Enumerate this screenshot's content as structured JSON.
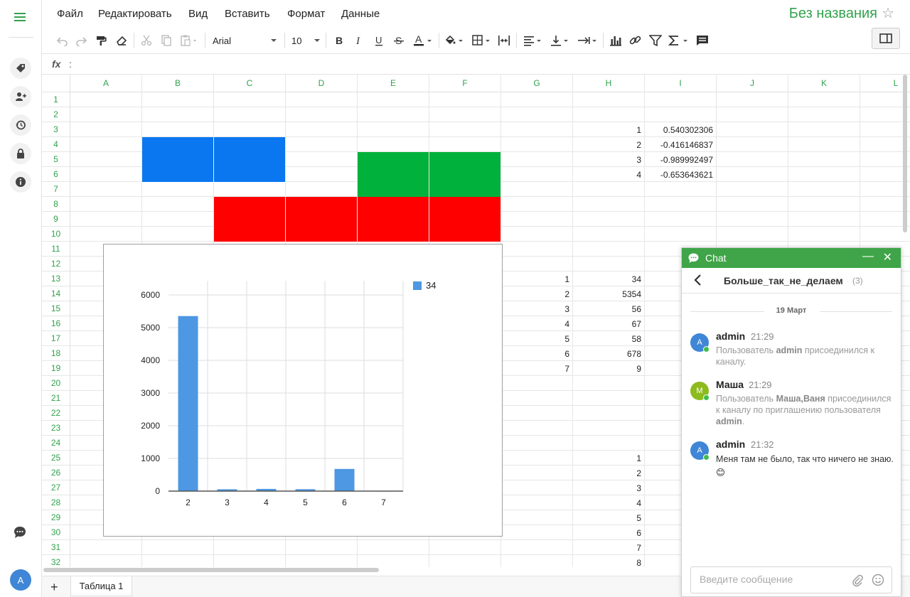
{
  "menu": [
    "Файл",
    "Редактировать",
    "Вид",
    "Вставить",
    "Формат",
    "Данные"
  ],
  "document_title": "Без названия",
  "toolbar": {
    "font_family": "Arial",
    "font_size": "10",
    "text_color": "#222222",
    "fill_color": "#222222"
  },
  "formula_bar": {
    "label": "fx",
    "separator": ":"
  },
  "columns": [
    "A",
    "B",
    "C",
    "D",
    "E",
    "F",
    "G",
    "H",
    "I",
    "J",
    "K",
    "L"
  ],
  "rows": [
    "1",
    "2",
    "3",
    "4",
    "5",
    "6",
    "7",
    "8",
    "9",
    "10",
    "11",
    "12",
    "13",
    "14",
    "15",
    "16",
    "17",
    "18",
    "19",
    "20",
    "21",
    "22",
    "23",
    "24",
    "25",
    "26",
    "27",
    "28",
    "29",
    "30",
    "31",
    "32"
  ],
  "cells": [
    {
      "ref": "H3",
      "value": "1"
    },
    {
      "ref": "I3",
      "value": "0.540302306"
    },
    {
      "ref": "H4",
      "value": "2"
    },
    {
      "ref": "I4",
      "value": "-0.416146837"
    },
    {
      "ref": "H5",
      "value": "3"
    },
    {
      "ref": "I5",
      "value": "-0.989992497"
    },
    {
      "ref": "H6",
      "value": "4"
    },
    {
      "ref": "I6",
      "value": "-0.653643621"
    },
    {
      "ref": "G13",
      "value": "1"
    },
    {
      "ref": "H13",
      "value": "34"
    },
    {
      "ref": "G14",
      "value": "2"
    },
    {
      "ref": "H14",
      "value": "5354"
    },
    {
      "ref": "G15",
      "value": "3"
    },
    {
      "ref": "H15",
      "value": "56"
    },
    {
      "ref": "G16",
      "value": "4"
    },
    {
      "ref": "H16",
      "value": "67"
    },
    {
      "ref": "G17",
      "value": "5"
    },
    {
      "ref": "H17",
      "value": "58"
    },
    {
      "ref": "G18",
      "value": "6"
    },
    {
      "ref": "H18",
      "value": "678"
    },
    {
      "ref": "G19",
      "value": "7"
    },
    {
      "ref": "H19",
      "value": "9"
    },
    {
      "ref": "H25",
      "value": "1"
    },
    {
      "ref": "H26",
      "value": "2"
    },
    {
      "ref": "H27",
      "value": "3"
    },
    {
      "ref": "H28",
      "value": "4"
    },
    {
      "ref": "H29",
      "value": "5"
    },
    {
      "ref": "H30",
      "value": "6"
    },
    {
      "ref": "H31",
      "value": "7"
    },
    {
      "ref": "H32",
      "value": "8"
    }
  ],
  "fills": [
    {
      "range": "B4:C6",
      "color": "#0a77f0"
    },
    {
      "range": "E5:F9",
      "color": "#00b13b"
    },
    {
      "range": "C8:F10",
      "color": "#ff0000"
    }
  ],
  "chart_data": {
    "type": "bar",
    "categories": [
      "2",
      "3",
      "4",
      "5",
      "6",
      "7"
    ],
    "series": [
      {
        "name": "34",
        "values": [
          5354,
          56,
          67,
          58,
          678,
          9
        ],
        "color": "#4d97e3"
      }
    ],
    "y_ticks": [
      "0",
      "1000",
      "2000",
      "3000",
      "4000",
      "5000",
      "6000"
    ],
    "ylim": [
      0,
      6000
    ],
    "grid": true,
    "legend_position": "top-right"
  },
  "sheet_tabs": {
    "add": "+",
    "tabs": [
      "Таблица 1"
    ]
  },
  "chat": {
    "title": "Chat",
    "minimize": "—",
    "close": "✕",
    "channel_name": "Больше_так_не_делаем",
    "member_count": "(3)",
    "date_separator": "19 Март",
    "messages": [
      {
        "avatar": "A",
        "avatar_color": "#3f86d6",
        "author": "admin",
        "time": "21:29",
        "parts": [
          "Пользователь ",
          "admin",
          " присоединился к каналу."
        ]
      },
      {
        "avatar": "M",
        "avatar_color": "#8dbb1e",
        "author": "Маша",
        "time": "21:29",
        "parts": [
          "Пользователь ",
          "Маша,Ваня",
          " присоединился к каналу по приглашению пользователя ",
          "admin",
          "."
        ]
      },
      {
        "avatar": "A",
        "avatar_color": "#3f86d6",
        "author": "admin",
        "time": "21:32",
        "text": "Меня там не было, так что ничего не знаю.",
        "emoji": "😊"
      }
    ],
    "input_placeholder": "Введите сообщение"
  },
  "user_avatar": "A"
}
